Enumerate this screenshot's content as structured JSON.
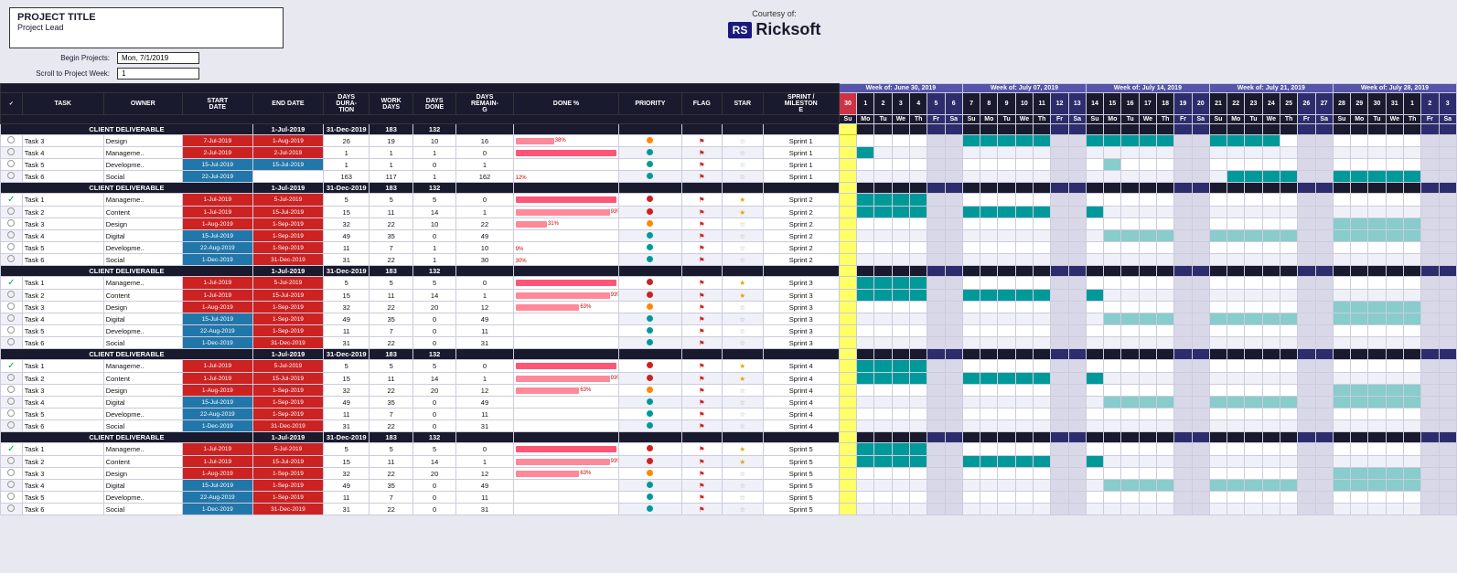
{
  "header": {
    "project_title": "PROJECT TITLE",
    "project_lead": "Project Lead",
    "courtesy_text": "Courtesy of:",
    "rs_badge": "RS",
    "company_name": "Ricksoft",
    "begin_projects_label": "Begin Projects:",
    "begin_projects_value": "Mon, 7/1/2019",
    "scroll_label": "Scroll to Project Week:",
    "scroll_value": "1"
  },
  "columns": {
    "headers": [
      "",
      "TASK",
      "OWNER",
      "START DATE",
      "END DATE",
      "DAYS DURATION",
      "WORK DAYS",
      "DAYS DONE",
      "DAYS REMAINING",
      "DONE %",
      "PRIORITY",
      "FLAG",
      "STAR",
      "SPRINT / MILESTONE"
    ]
  },
  "weeks": [
    {
      "label": "Week of: June 30, 2019",
      "days": [
        1,
        2,
        3,
        4,
        5,
        "Su",
        "Mo",
        "Tu",
        "We",
        "Th",
        "Fr"
      ]
    },
    {
      "label": "Week of: July 07, 2019",
      "days": [
        7,
        8,
        9,
        10,
        11,
        12,
        13,
        "Su",
        "Mo",
        "Tu",
        "We",
        "Th",
        "Fr",
        "Sa"
      ]
    },
    {
      "label": "Week of: July 14, 2019",
      "days": [
        14,
        15,
        16,
        17,
        18,
        19,
        20,
        "Su",
        "Mo",
        "Tu",
        "We",
        "Th",
        "Fr",
        "Sa"
      ]
    },
    {
      "label": "Week of: July 21, 2019",
      "days": [
        21,
        22,
        23,
        24,
        25,
        26,
        "Su",
        "Mo",
        "Tu",
        "We",
        "Th",
        "Fr"
      ]
    },
    {
      "label": "Week of: July 28, 2019",
      "days": [
        28,
        29,
        30,
        31,
        1,
        2,
        "Su",
        "Mo",
        "Tu",
        "We",
        "Th",
        "Fr"
      ]
    }
  ],
  "sprints": [
    {
      "type": "deliverable",
      "task": "CLIENT DELIVERABLE",
      "start": "1-Jul-2019",
      "end": "31-Dec-2019",
      "duration": 183,
      "workdays": 132
    },
    {
      "type": "task",
      "id": "t3",
      "task": "Task 3",
      "owner": "Design",
      "start": "7-Jul-2019",
      "end": "1-Aug-2019",
      "duration": 26,
      "workdays": 19,
      "done": 10,
      "remaining": 16,
      "pct": 38,
      "priority": "orange",
      "flag": true,
      "star": false,
      "sprint": "Sprint 1"
    },
    {
      "type": "task",
      "id": "t4",
      "task": "Task 4",
      "owner": "Management",
      "start": "2-Jul-2019",
      "end": "2-Jul-2019",
      "duration": 1,
      "workdays": 1,
      "done": 1,
      "remaining": 0,
      "pct": 100,
      "priority": "teal",
      "flag": true,
      "star": false,
      "sprint": "Sprint 1"
    },
    {
      "type": "task",
      "id": "t5",
      "task": "Task 5",
      "owner": "Development",
      "start": "15-Jul-2019",
      "end": "15-Jul-2019",
      "duration": 1,
      "workdays": 1,
      "done": 0,
      "remaining": 1,
      "pct": 0,
      "priority": "teal",
      "flag": true,
      "star": false,
      "sprint": "Sprint 1"
    },
    {
      "type": "task",
      "id": "t6",
      "task": "Task 6",
      "owner": "Social",
      "start": "22-Jul-2019",
      "end": "",
      "duration": 163,
      "workdays": 117,
      "done": 1,
      "remaining": 162,
      "pct": 12,
      "priority": "teal",
      "flag": true,
      "star": false,
      "sprint": "Sprint 1"
    }
  ]
}
